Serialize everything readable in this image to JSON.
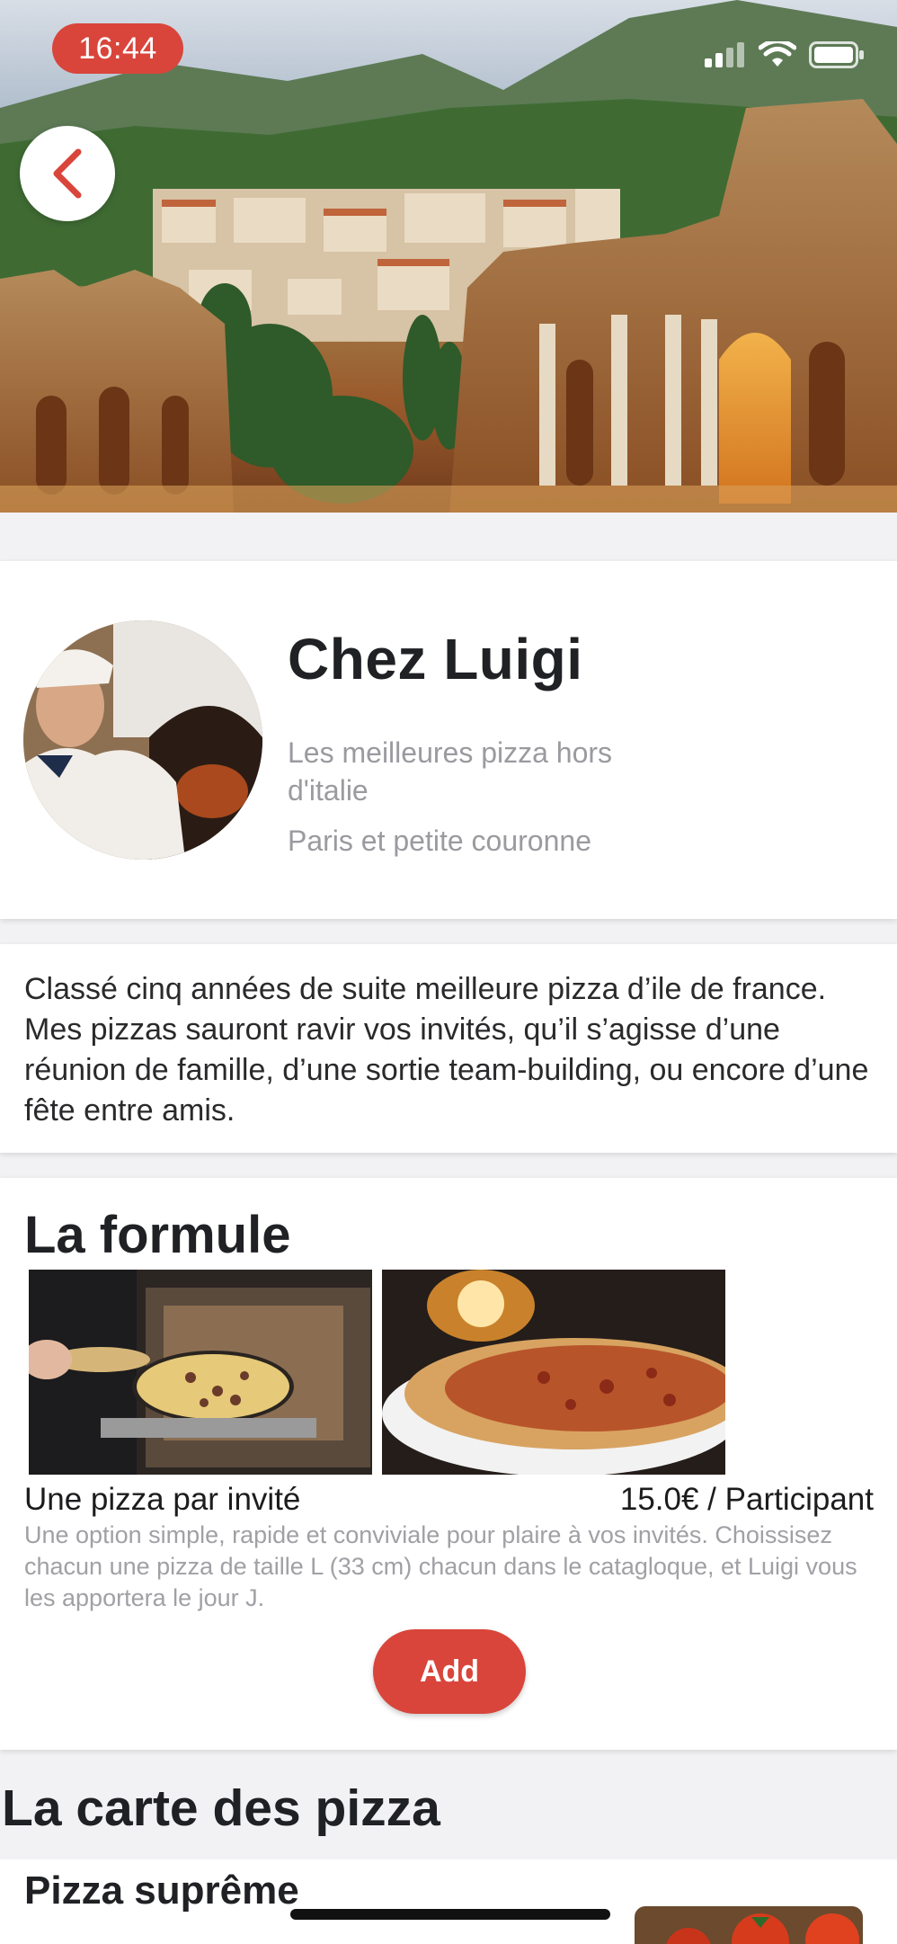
{
  "status_bar": {
    "time": "16:44",
    "icons": [
      "signal-icon",
      "wifi-icon",
      "battery-icon"
    ]
  },
  "hero": {
    "back_icon": "chevron-left-icon"
  },
  "profile": {
    "name": "Chez Luigi",
    "tagline": "Les meilleures pizza hors d'italie",
    "area": "Paris et petite couronne"
  },
  "description": "Classé cinq années de suite meilleure pizza d’ile de france. Mes pizzas sauront ravir vos invités, qu’il s’agisse d’une réunion de famille, d’une sortie team-building, ou encore d’une fête entre amis.",
  "formule": {
    "title": "La formule",
    "name": "Une pizza par invité",
    "price": "15.0€ / Participant",
    "description": "Une option simple, rapide et conviviale pour plaire à vos invités. Choissisez chacun une pizza de taille L (33 cm) chacun dans le catagloque, et Luigi vous les apportera le jour J.",
    "add_label": "Add"
  },
  "carte": {
    "title": "La carte des pizza",
    "first_pizza": "Pizza suprême"
  },
  "colors": {
    "accent": "#d9453b",
    "muted_text": "#9a9a9f"
  }
}
